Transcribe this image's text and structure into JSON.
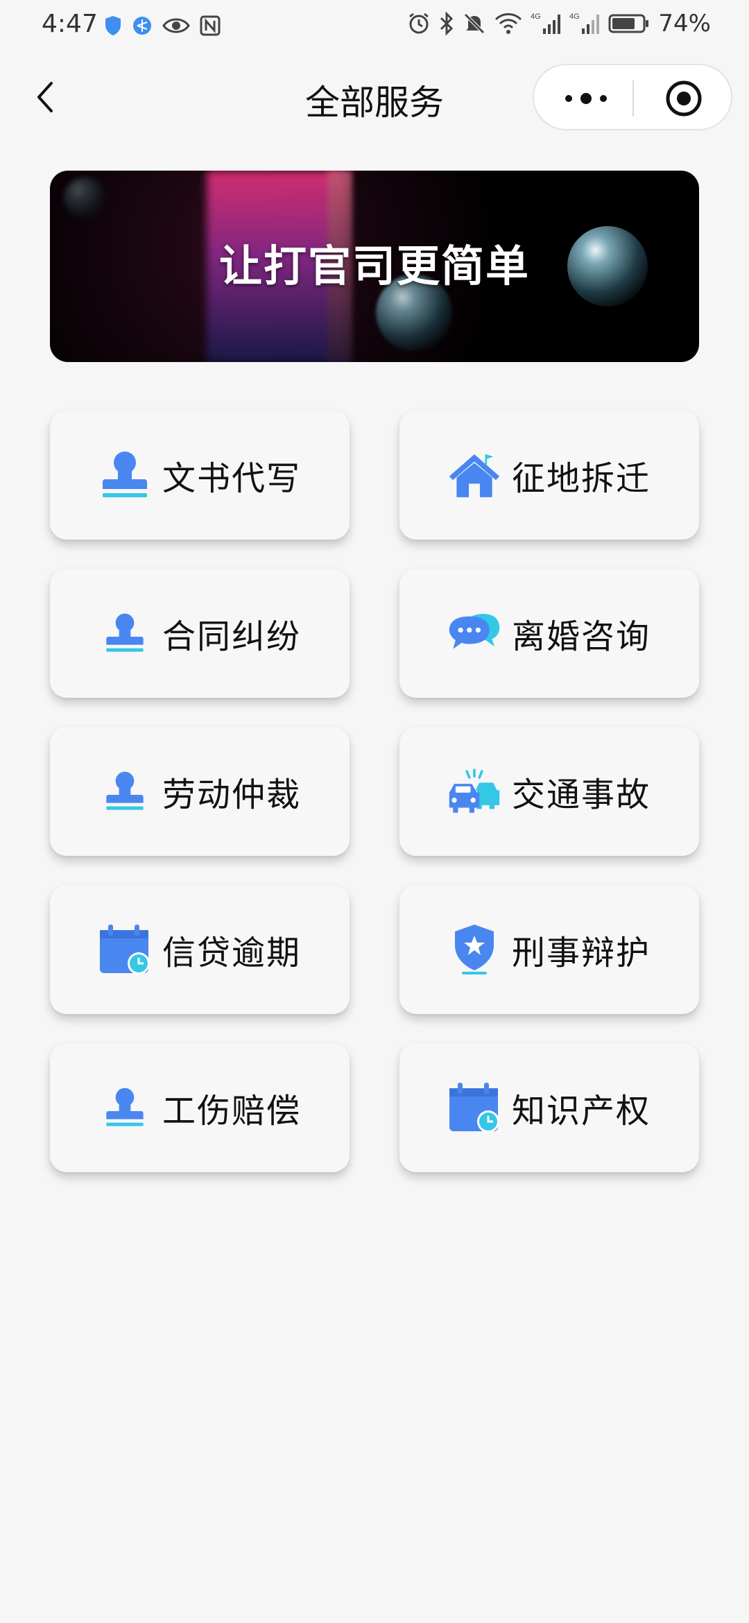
{
  "status_bar": {
    "time": "4:47",
    "battery": "74%",
    "left_icons": [
      "shield-icon",
      "network-icon",
      "eye-icon",
      "nfc-icon"
    ],
    "right_icons": [
      "alarm-icon",
      "bluetooth-icon",
      "mute-icon",
      "wifi-icon",
      "signal-4g-icon",
      "signal-4g-icon",
      "battery-icon"
    ]
  },
  "nav": {
    "title": "全部服务"
  },
  "banner": {
    "text": "让打官司更简单"
  },
  "services": [
    {
      "label": "文书代写",
      "icon": "person-stamp-icon"
    },
    {
      "label": "征地拆迁",
      "icon": "house-icon"
    },
    {
      "label": "合同纠纷",
      "icon": "person-stamp-icon"
    },
    {
      "label": "离婚咨询",
      "icon": "chat-bubbles-icon"
    },
    {
      "label": "劳动仲裁",
      "icon": "person-stamp-icon"
    },
    {
      "label": "交通事故",
      "icon": "car-crash-icon"
    },
    {
      "label": "信贷逾期",
      "icon": "calendar-clock-icon"
    },
    {
      "label": "刑事辩护",
      "icon": "shield-star-icon"
    },
    {
      "label": "工伤赔偿",
      "icon": "person-stamp-icon"
    },
    {
      "label": "知识产权",
      "icon": "calendar-clock-icon"
    }
  ],
  "colors": {
    "accent_blue": "#4a86f0",
    "accent_cyan": "#35c7e6",
    "background": "#f6f6f7"
  }
}
